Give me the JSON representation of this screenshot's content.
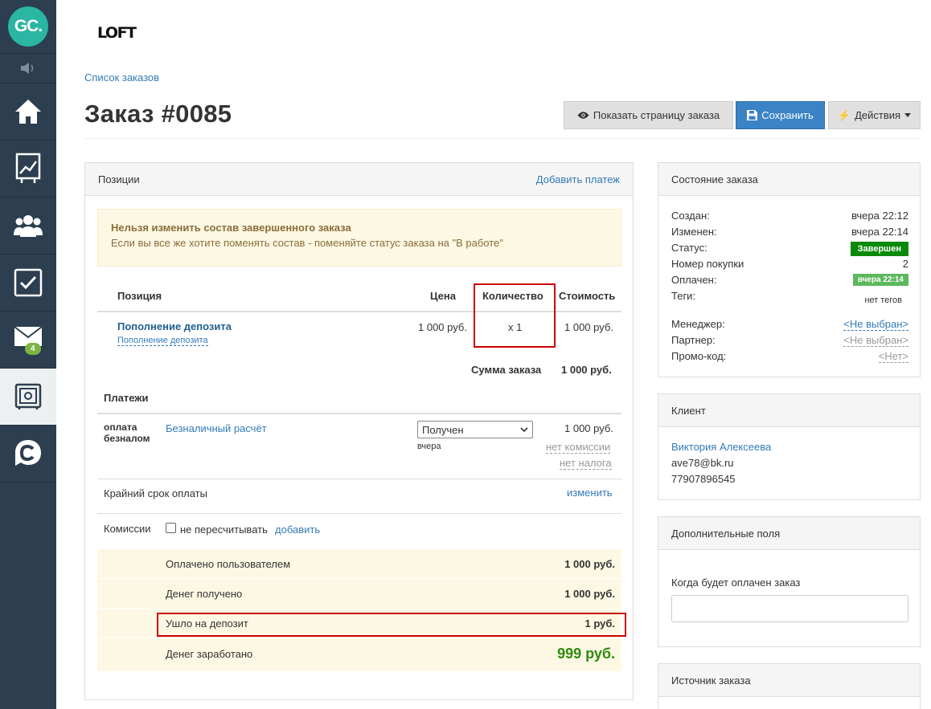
{
  "sidebar": {
    "logo": "GC.",
    "mail_badge": "4",
    "items": [
      "home-icon",
      "chart-icon",
      "users-icon",
      "tasks-icon",
      "mail-icon",
      "safe-icon",
      "getcourse-icon"
    ]
  },
  "header": {
    "brand": "LOFT",
    "breadcrumb": "Список заказов",
    "title": "Заказ #0085",
    "btn_show": "Показать страницу заказа",
    "btn_save": "Сохранить",
    "btn_actions": "Действия"
  },
  "positions": {
    "title": "Позиции",
    "add_payment": "Добавить платеж",
    "warning_title": "Нельзя изменить состав завершенного заказа",
    "warning_text": "Если вы все же хотите поменять состав - поменяйте статус заказа на \"В работе\"",
    "col_position": "Позиция",
    "col_price": "Цена",
    "col_qty": "Количество",
    "col_cost": "Стоимость",
    "item_name": "Пополнение депозита",
    "item_sub": "Пополнение депозита",
    "item_price": "1 000 руб.",
    "item_qty": "x 1",
    "item_cost": "1 000 руб.",
    "order_sum_label": "Сумма заказа",
    "order_sum": "1 000 руб."
  },
  "payments": {
    "title": "Платежи",
    "method": "оплата безналом",
    "type": "Безналичный расчёт",
    "status": "Получен",
    "date": "вчера",
    "amount": "1 000 руб.",
    "no_commission": "нет комиссии",
    "no_tax": "нет налога",
    "deadline_label": "Крайний срок оплаты",
    "deadline_link": "изменить",
    "commissions_label": "Комиссии",
    "no_recalc": "не пересчитывать",
    "add": "добавить"
  },
  "totals": {
    "paid_user_label": "Оплачено пользователем",
    "paid_user": "1 000 руб.",
    "received_label": "Денег получено",
    "received": "1 000 руб.",
    "deposit_label": "Ушло на депозит",
    "deposit": "1 руб.",
    "earned_label": "Денег заработано",
    "earned": "999 руб."
  },
  "state": {
    "title": "Состояние заказа",
    "created_label": "Создан:",
    "created": "вчера 22:12",
    "changed_label": "Изменен:",
    "changed": "вчера 22:14",
    "status_label": "Статус:",
    "status": "Завершен",
    "purchase_label": "Номер покупки",
    "purchase": "2",
    "paid_label": "Оплачен:",
    "paid": "вчера 22:14",
    "tags_label": "Теги:",
    "tags": "нет тегов",
    "manager_label": "Менеджер:",
    "manager": "<Не выбран>",
    "partner_label": "Партнер:",
    "partner": "<Не выбран>",
    "promo_label": "Промо-код:",
    "promo": "<Нет>"
  },
  "client": {
    "title": "Клиент",
    "name": "Виктория Алексеева",
    "email": "ave78@bk.ru",
    "phone": "77907896545"
  },
  "extra": {
    "title": "Дополнительные поля",
    "field_label": "Когда будет оплачен заказ",
    "field_value": ""
  },
  "source": {
    "title": "Источник заказа"
  },
  "colors": {
    "sidebar": "#2c3e50",
    "accent": "#3a83c4",
    "success": "#0a8a0a",
    "highlight": "#c00000"
  }
}
